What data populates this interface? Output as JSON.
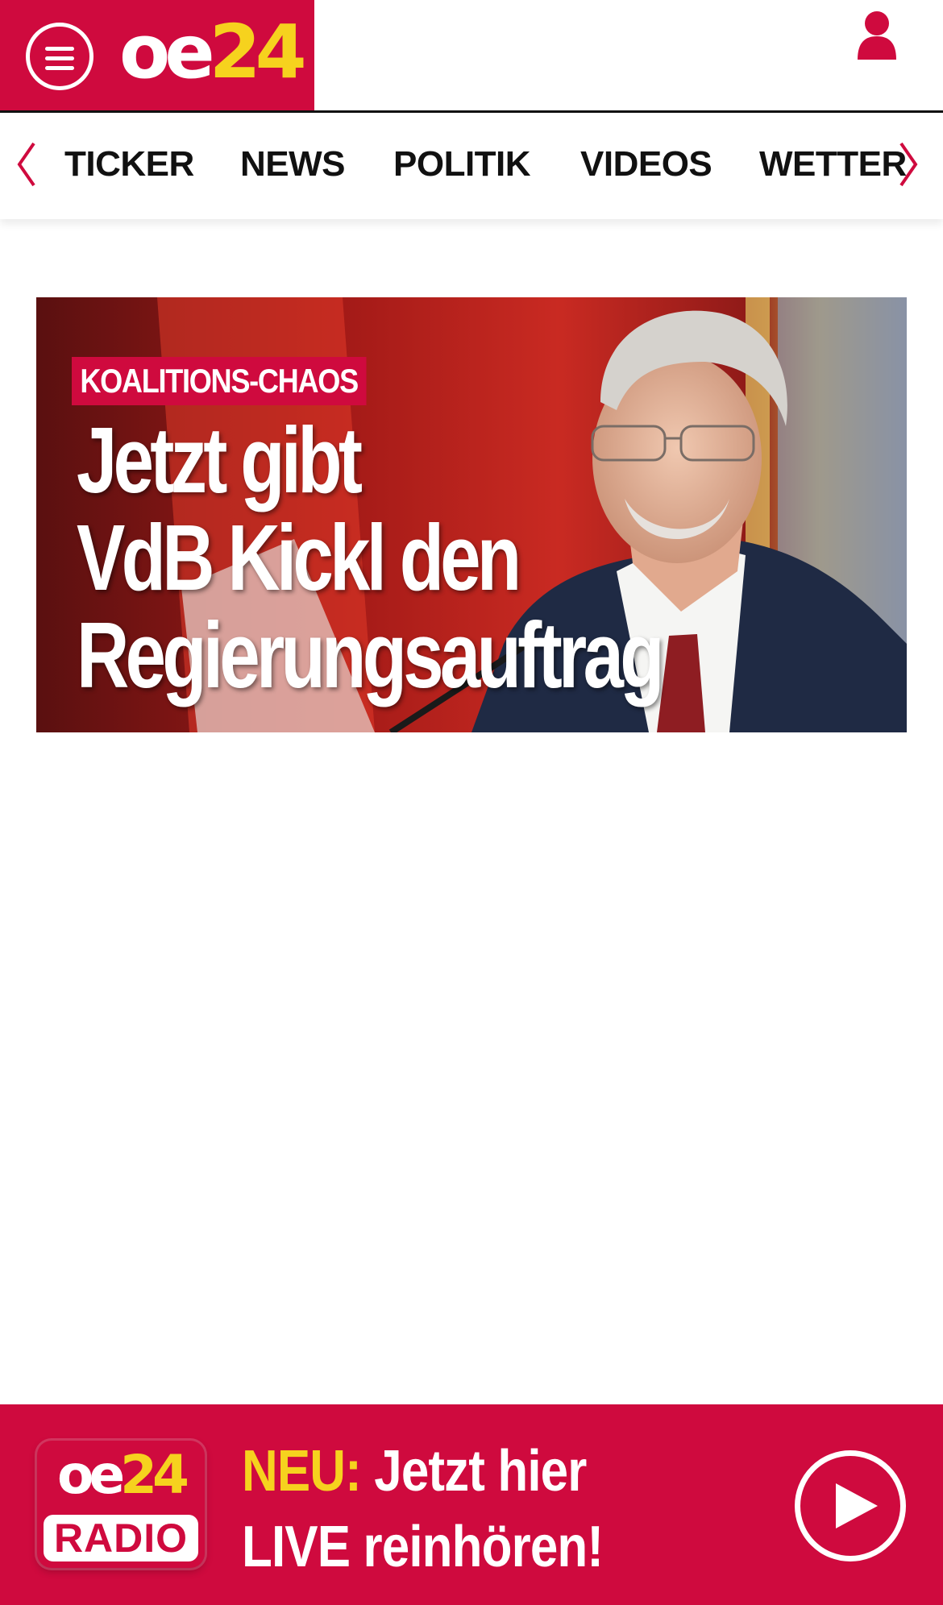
{
  "header": {
    "menu_icon": "hamburger-menu-icon",
    "logo": {
      "part1": "oe",
      "part2": "24"
    },
    "user_icon": "user-icon",
    "colors": {
      "brand": "#cf0a3e",
      "accent": "#f6d21e"
    }
  },
  "nav": {
    "prev_icon": "chevron-left-icon",
    "next_icon": "chevron-right-icon",
    "items": [
      {
        "label": "TICKER"
      },
      {
        "label": "NEWS"
      },
      {
        "label": "POLITIK"
      },
      {
        "label": "VIDEOS"
      },
      {
        "label": "WETTER"
      }
    ]
  },
  "hero": {
    "kicker": "KOALITIONS-CHAOS",
    "headline_lines": [
      "Jetzt gibt",
      "VdB Kickl den",
      "Regierungsauftrag"
    ]
  },
  "radio_banner": {
    "logo": {
      "part1": "oe",
      "part2": "24"
    },
    "badge_label": "RADIO",
    "neu": "NEU:",
    "line1_rest": " Jetzt hier",
    "line2": "LIVE reinhören!",
    "play_icon": "play-icon"
  }
}
